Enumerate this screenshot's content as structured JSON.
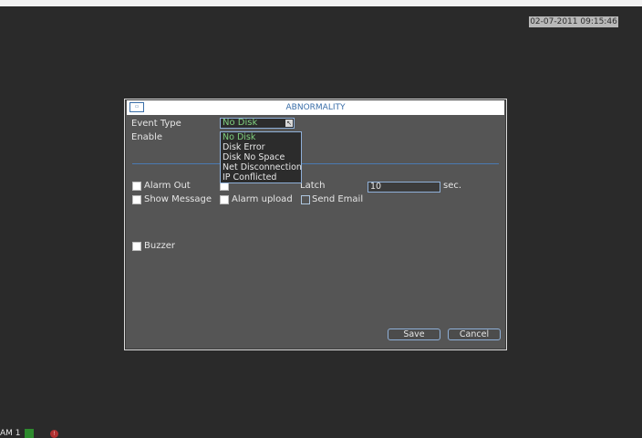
{
  "datetime": "02-07-2011 09:15:46",
  "dialog": {
    "title": "ABNORMALITY",
    "event_type_label": "Event Type",
    "event_type_value": "No Disk",
    "enable_label": "Enable",
    "event_type_options": [
      "No Disk",
      "Disk Error",
      "Disk No Space",
      "Net Disconnection",
      "IP Conflicted"
    ],
    "alarm_out_label": "Alarm Out",
    "latch_label": "Latch",
    "latch_value": "10",
    "latch_unit": "sec.",
    "show_message_label": "Show Message",
    "alarm_upload_label": "Alarm upload",
    "send_email_label": "Send Email",
    "buzzer_label": "Buzzer",
    "save_label": "Save",
    "cancel_label": "Cancel"
  },
  "statusbar": {
    "text": "AM 1"
  },
  "colors": {
    "dialog_bg": "#555555",
    "accent_border": "#8fb0d8",
    "selected_text": "#7fd07f",
    "title_text": "#3a6ea8"
  }
}
